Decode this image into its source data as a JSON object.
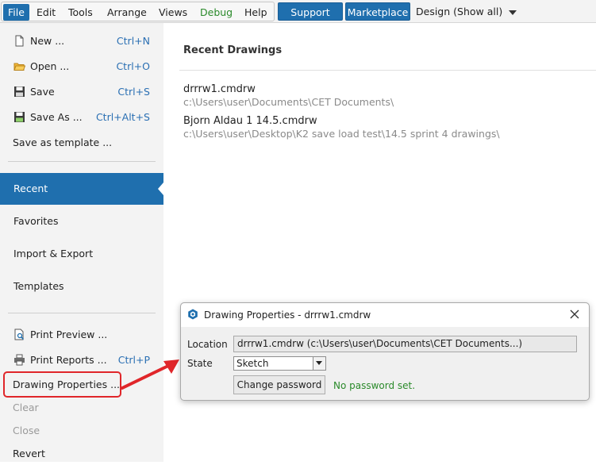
{
  "menubar": {
    "items": [
      {
        "label": "File",
        "active": true
      },
      {
        "label": "Edit"
      },
      {
        "label": "Tools"
      },
      {
        "label": "Arrange"
      },
      {
        "label": "Views"
      },
      {
        "label": "Debug"
      },
      {
        "label": "Help"
      }
    ],
    "support_label": "Support",
    "marketplace_label": "Marketplace",
    "design_label": "Design (Show all)"
  },
  "sidebar": {
    "commands": [
      {
        "label": "New ...",
        "shortcut": "Ctrl+N",
        "icon": "new-document-icon"
      },
      {
        "label": "Open ...",
        "shortcut": "Ctrl+O",
        "icon": "folder-icon"
      },
      {
        "label": "Save",
        "shortcut": "Ctrl+S",
        "icon": "floppy-icon"
      },
      {
        "label": "Save As ...",
        "shortcut": "Ctrl+Alt+S",
        "icon": "floppy-icon"
      },
      {
        "label": "Save as template ..."
      }
    ],
    "nav": [
      {
        "label": "Recent",
        "active": true
      },
      {
        "label": "Favorites"
      },
      {
        "label": "Import & Export"
      },
      {
        "label": "Templates"
      }
    ],
    "print": [
      {
        "label": "Print Preview ...",
        "icon": "print-preview-icon"
      },
      {
        "label": "Print Reports ...",
        "shortcut": "Ctrl+P",
        "icon": "printer-icon"
      }
    ],
    "bottom": [
      {
        "label": "Drawing Properties ...",
        "enabled": true
      },
      {
        "label": "Clear",
        "enabled": false
      },
      {
        "label": "Close",
        "enabled": false
      },
      {
        "label": "Revert",
        "enabled": true
      }
    ]
  },
  "content": {
    "title": "Recent Drawings",
    "recent": [
      {
        "name": "drrrw1.cmdrw",
        "path": "c:\\Users\\user\\Documents\\CET Documents\\"
      },
      {
        "name": "Bjorn Aldau 1 14.5.cmdrw",
        "path": "c:\\Users\\user\\Desktop\\K2 save load test\\14.5  sprint 4 drawings\\"
      }
    ]
  },
  "dialog": {
    "title": "Drawing Properties - drrrw1.cmdrw",
    "location_label": "Location",
    "location_value": "drrrw1.cmdrw (c:\\Users\\user\\Documents\\CET Documents...)",
    "state_label": "State",
    "state_value": "Sketch",
    "change_password_label": "Change password",
    "password_status": "No password set."
  },
  "colors": {
    "accent": "#1f6fae",
    "highlight": "#e0262a",
    "status_ok": "#2a8a2a",
    "shortcut": "#2a6fb3"
  }
}
